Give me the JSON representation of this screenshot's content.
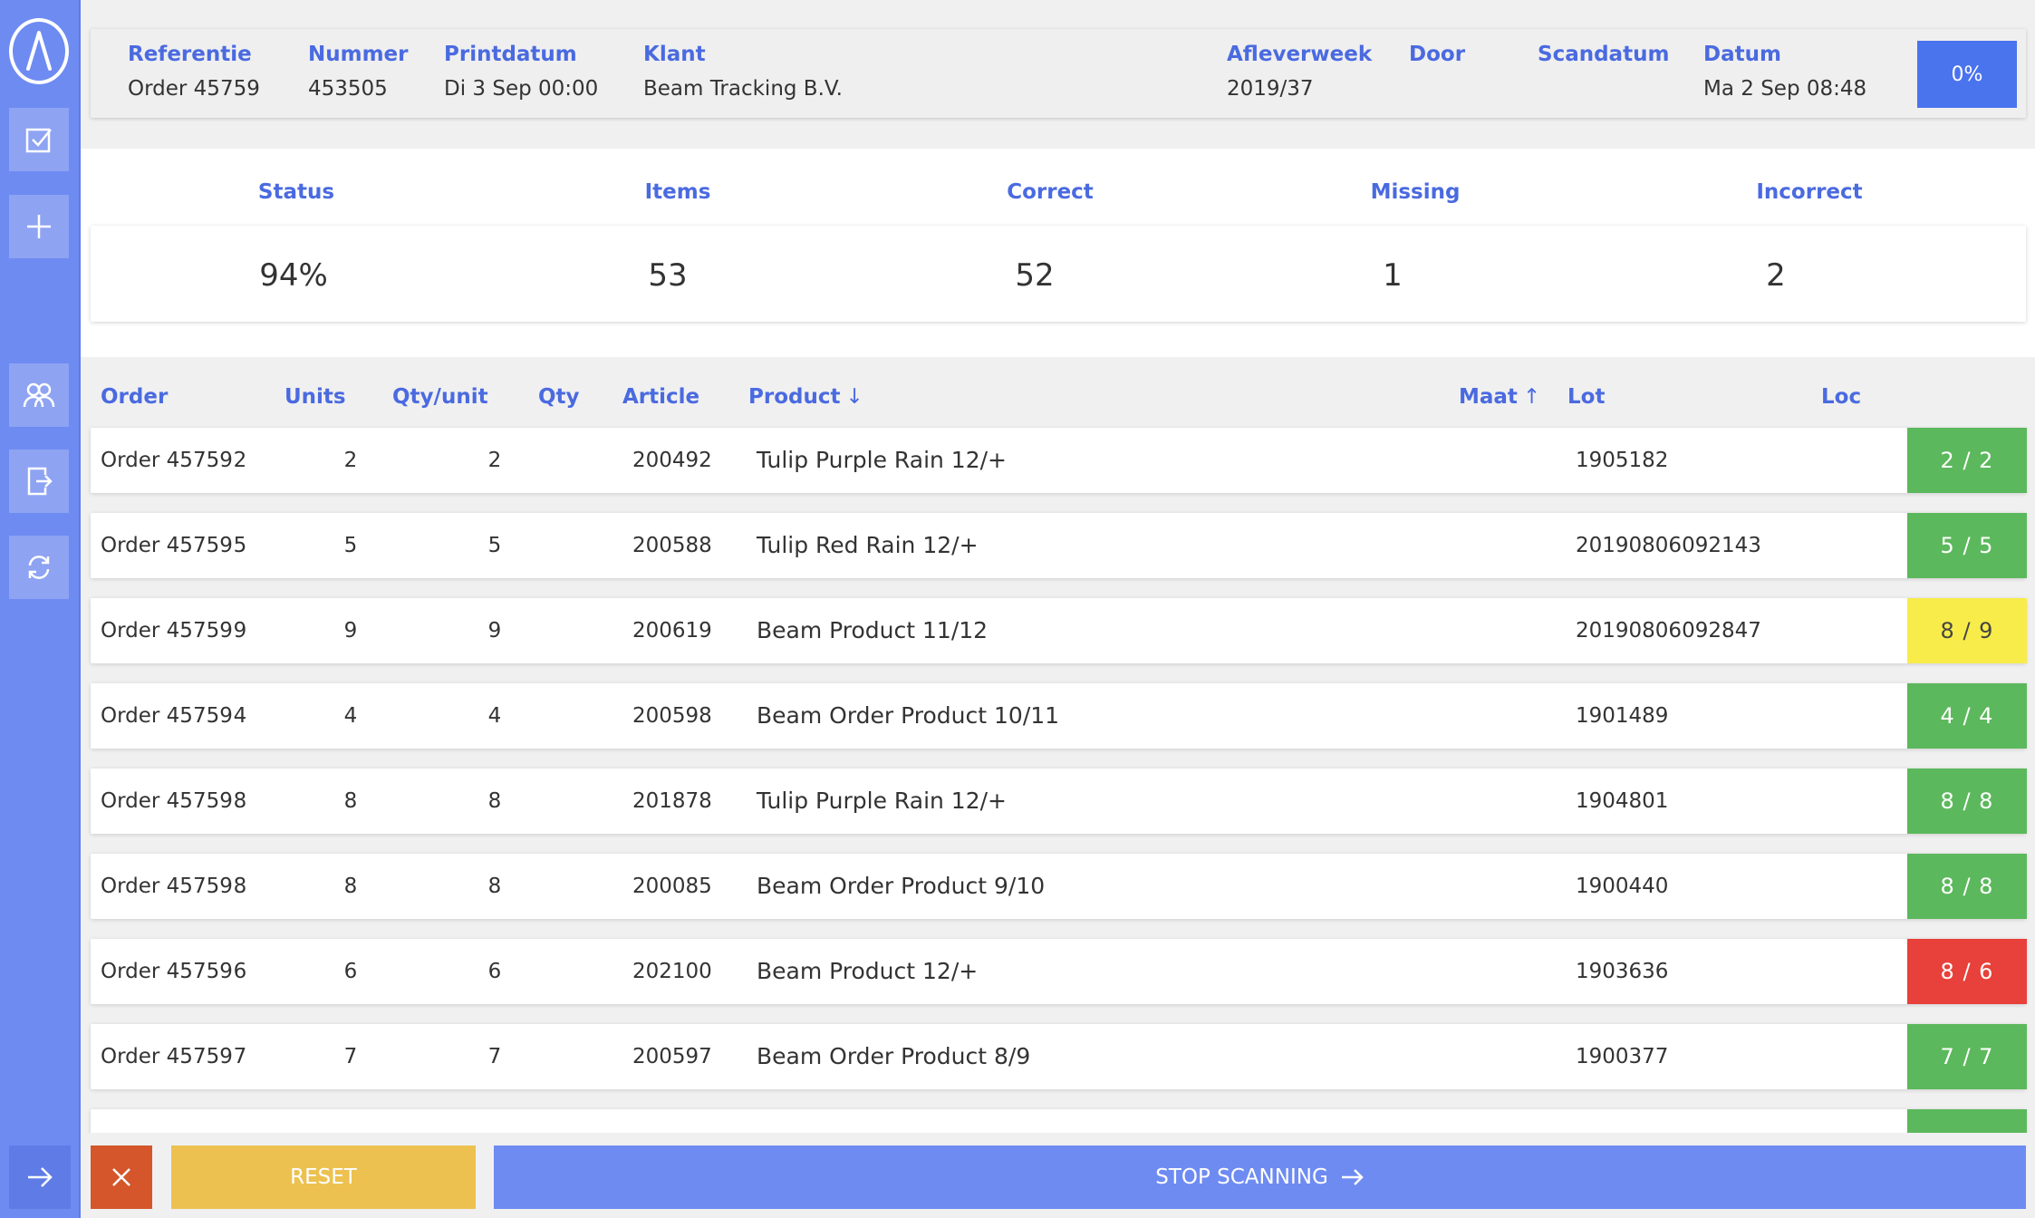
{
  "header": {
    "fields": [
      {
        "label": "Referentie",
        "value": "Order 45759"
      },
      {
        "label": "Nummer",
        "value": "453505"
      },
      {
        "label": "Printdatum",
        "value": "Di 3 Sep 00:00"
      },
      {
        "label": "Klant",
        "value": "Beam Tracking B.V."
      },
      {
        "label": "Afleverweek",
        "value": "2019/37"
      },
      {
        "label": "Door",
        "value": ""
      },
      {
        "label": "Scandatum",
        "value": ""
      },
      {
        "label": "Datum",
        "value": "Ma 2 Sep 08:48"
      }
    ],
    "progress_button": "0%"
  },
  "stats": {
    "labels": [
      "Status",
      "Items",
      "Correct",
      "Missing",
      "Incorrect"
    ],
    "values": [
      "94%",
      "53",
      "52",
      "1",
      "2"
    ]
  },
  "table": {
    "columns": {
      "order": "Order",
      "units": "Units",
      "qty_unit": "Qty/unit",
      "qty": "Qty",
      "article": "Article",
      "product": "Product",
      "maat": "Maat",
      "lot": "Lot",
      "loc": "Loc"
    },
    "sort": {
      "product": "↓",
      "maat": "↑"
    },
    "rows": [
      {
        "order": "Order 45759",
        "units": "2",
        "qty_unit": "2",
        "qty": "2",
        "article": "200492",
        "product": "Tulip Purple Rain 12/+",
        "lot": "1905182",
        "scan": "2 / 2",
        "status": "green"
      },
      {
        "order": "Order 45759",
        "units": "5",
        "qty_unit": "5",
        "qty": "5",
        "article": "200588",
        "product": "Tulip Red Rain 12/+",
        "lot": "20190806092143",
        "scan": "5 / 5",
        "status": "green"
      },
      {
        "order": "Order 45759",
        "units": "9",
        "qty_unit": "9",
        "qty": "9",
        "article": "200619",
        "product": "Beam Product 11/12",
        "lot": "20190806092847",
        "scan": "8 / 9",
        "status": "yellow"
      },
      {
        "order": "Order 45759",
        "units": "4",
        "qty_unit": "4",
        "qty": "4",
        "article": "200598",
        "product": "Beam Order Product 10/11",
        "lot": "1901489",
        "scan": "4 / 4",
        "status": "green"
      },
      {
        "order": "Order 45759",
        "units": "8",
        "qty_unit": "8",
        "qty": "8",
        "article": "201878",
        "product": "Tulip Purple Rain 12/+",
        "lot": "1904801",
        "scan": "8 / 8",
        "status": "green"
      },
      {
        "order": "Order 45759",
        "units": "8",
        "qty_unit": "8",
        "qty": "8",
        "article": "200085",
        "product": "Beam Order Product 9/10",
        "lot": "1900440",
        "scan": "8 / 8",
        "status": "green"
      },
      {
        "order": "Order 45759",
        "units": "6",
        "qty_unit": "6",
        "qty": "6",
        "article": "202100",
        "product": "Beam Product 12/+",
        "lot": "1903636",
        "scan": "8 / 6",
        "status": "red"
      },
      {
        "order": "Order 45759",
        "units": "7",
        "qty_unit": "7",
        "qty": "7",
        "article": "200597",
        "product": "Beam Order Product 8/9",
        "lot": "1900377",
        "scan": "7 / 7",
        "status": "green"
      }
    ]
  },
  "buttons": {
    "reset": "RESET",
    "stop": "STOP SCANNING"
  },
  "colors": {
    "accent": "#4a6ae0",
    "sidebar": "#6e8bf2",
    "green": "#5cb85c",
    "yellow": "#f8ec4a",
    "red": "#e8403a",
    "reset": "#ecc14f",
    "close": "#d4562a"
  },
  "icons": {
    "sidebar": [
      "logo-icon",
      "checkbox-icon",
      "plus-icon",
      "users-icon",
      "logout-icon",
      "refresh-icon",
      "arrow-right-icon"
    ],
    "close": "close-icon",
    "stop": "arrow-right-icon"
  }
}
